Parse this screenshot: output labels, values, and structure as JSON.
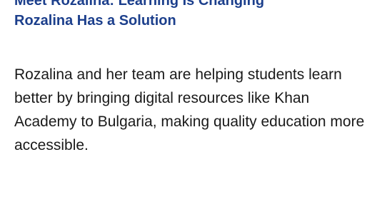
{
  "heading": {
    "line_partial": "Meet Rozalina: Learning Is Changing",
    "line_full": "Rozalina Has a Solution"
  },
  "body": {
    "paragraph": "Rozalina and her team are helping students learn better by bringing digital resources like Khan Academy to Bulgaria, making quality education more accessible."
  },
  "colors": {
    "heading": "#1c3f8c",
    "text": "#1a1a1a",
    "background": "#ffffff"
  }
}
